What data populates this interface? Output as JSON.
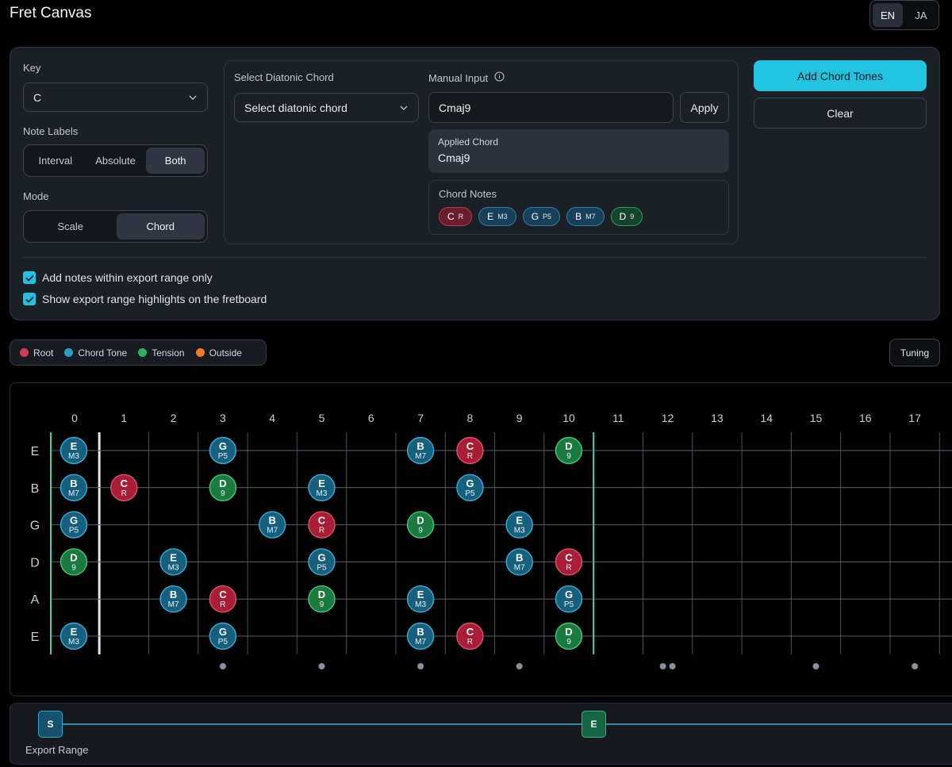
{
  "app": {
    "title": "Fret Canvas"
  },
  "language": {
    "options": [
      "EN",
      "JA"
    ],
    "selected": "EN"
  },
  "controls": {
    "key_label": "Key",
    "key_value": "C",
    "note_labels_label": "Note Labels",
    "note_labels_options": [
      "Interval",
      "Absolute",
      "Both"
    ],
    "note_labels_selected": "Both",
    "mode_label": "Mode",
    "mode_options": [
      "Scale",
      "Chord"
    ],
    "mode_selected": "Chord",
    "diatonic_label": "Select Diatonic Chord",
    "diatonic_placeholder": "Select diatonic chord",
    "manual_label": "Manual Input",
    "manual_value": "Cmaj9",
    "apply_label": "Apply",
    "applied_title": "Applied Chord",
    "applied_value": "Cmaj9",
    "chord_notes_title": "Chord Notes",
    "chord_notes": [
      {
        "note": "C",
        "interval": "R",
        "role": "root"
      },
      {
        "note": "E",
        "interval": "M3",
        "role": "tone"
      },
      {
        "note": "G",
        "interval": "P5",
        "role": "tone"
      },
      {
        "note": "B",
        "interval": "M7",
        "role": "tone"
      },
      {
        "note": "D",
        "interval": "9",
        "role": "tension"
      }
    ],
    "add_button": "Add Chord Tones",
    "clear_button": "Clear",
    "checkbox_export_only": "Add notes within export range only",
    "checkbox_show_highlights": "Show export range highlights on the fretboard"
  },
  "legend": [
    {
      "label": "Root",
      "color": "#d63a52"
    },
    {
      "label": "Chord Tone",
      "color": "#2a9ec6"
    },
    {
      "label": "Tension",
      "color": "#2fb05e"
    },
    {
      "label": "Outside",
      "color": "#f07a2a"
    }
  ],
  "tuning_button": "Tuning",
  "colors": {
    "root_fill": "#a81e35",
    "root_stroke": "#e0526a",
    "tone_fill": "#16607e",
    "tone_stroke": "#3aaed6",
    "tension_fill": "#1b7a3e",
    "tension_stroke": "#48c77a",
    "range_marker": "#3fd2b0"
  },
  "fretboard": {
    "frets": [
      "0",
      "1",
      "2",
      "3",
      "4",
      "5",
      "6",
      "7",
      "8",
      "9",
      "10",
      "11",
      "12",
      "13",
      "14",
      "15",
      "16",
      "17"
    ],
    "strings": [
      "E",
      "B",
      "G",
      "D",
      "A",
      "E"
    ],
    "inlay_frets": [
      3,
      5,
      7,
      9,
      15,
      17
    ],
    "double_inlay_frets": [
      12
    ],
    "range_start_fret": 0,
    "range_end_fret": 10,
    "notes": [
      {
        "string": 0,
        "fret": 0,
        "note": "E",
        "interval": "M3",
        "role": "tone"
      },
      {
        "string": 0,
        "fret": 3,
        "note": "G",
        "interval": "P5",
        "role": "tone"
      },
      {
        "string": 0,
        "fret": 7,
        "note": "B",
        "interval": "M7",
        "role": "tone"
      },
      {
        "string": 0,
        "fret": 8,
        "note": "C",
        "interval": "R",
        "role": "root"
      },
      {
        "string": 0,
        "fret": 10,
        "note": "D",
        "interval": "9",
        "role": "tension"
      },
      {
        "string": 1,
        "fret": 0,
        "note": "B",
        "interval": "M7",
        "role": "tone"
      },
      {
        "string": 1,
        "fret": 1,
        "note": "C",
        "interval": "R",
        "role": "root"
      },
      {
        "string": 1,
        "fret": 3,
        "note": "D",
        "interval": "9",
        "role": "tension"
      },
      {
        "string": 1,
        "fret": 5,
        "note": "E",
        "interval": "M3",
        "role": "tone"
      },
      {
        "string": 1,
        "fret": 8,
        "note": "G",
        "interval": "P5",
        "role": "tone"
      },
      {
        "string": 2,
        "fret": 0,
        "note": "G",
        "interval": "P5",
        "role": "tone"
      },
      {
        "string": 2,
        "fret": 4,
        "note": "B",
        "interval": "M7",
        "role": "tone"
      },
      {
        "string": 2,
        "fret": 5,
        "note": "C",
        "interval": "R",
        "role": "root"
      },
      {
        "string": 2,
        "fret": 7,
        "note": "D",
        "interval": "9",
        "role": "tension"
      },
      {
        "string": 2,
        "fret": 9,
        "note": "E",
        "interval": "M3",
        "role": "tone"
      },
      {
        "string": 3,
        "fret": 0,
        "note": "D",
        "interval": "9",
        "role": "tension"
      },
      {
        "string": 3,
        "fret": 2,
        "note": "E",
        "interval": "M3",
        "role": "tone"
      },
      {
        "string": 3,
        "fret": 5,
        "note": "G",
        "interval": "P5",
        "role": "tone"
      },
      {
        "string": 3,
        "fret": 9,
        "note": "B",
        "interval": "M7",
        "role": "tone"
      },
      {
        "string": 3,
        "fret": 10,
        "note": "C",
        "interval": "R",
        "role": "root"
      },
      {
        "string": 4,
        "fret": 2,
        "note": "B",
        "interval": "M7",
        "role": "tone"
      },
      {
        "string": 4,
        "fret": 3,
        "note": "C",
        "interval": "R",
        "role": "root"
      },
      {
        "string": 4,
        "fret": 5,
        "note": "D",
        "interval": "9",
        "role": "tension"
      },
      {
        "string": 4,
        "fret": 7,
        "note": "E",
        "interval": "M3",
        "role": "tone"
      },
      {
        "string": 4,
        "fret": 10,
        "note": "G",
        "interval": "P5",
        "role": "tone"
      },
      {
        "string": 5,
        "fret": 0,
        "note": "E",
        "interval": "M3",
        "role": "tone"
      },
      {
        "string": 5,
        "fret": 3,
        "note": "G",
        "interval": "P5",
        "role": "tone"
      },
      {
        "string": 5,
        "fret": 7,
        "note": "B",
        "interval": "M7",
        "role": "tone"
      },
      {
        "string": 5,
        "fret": 8,
        "note": "C",
        "interval": "R",
        "role": "root"
      },
      {
        "string": 5,
        "fret": 10,
        "note": "D",
        "interval": "9",
        "role": "tension"
      }
    ]
  },
  "export_range": {
    "label": "Export Range",
    "start_handle": "S",
    "end_handle": "E"
  }
}
